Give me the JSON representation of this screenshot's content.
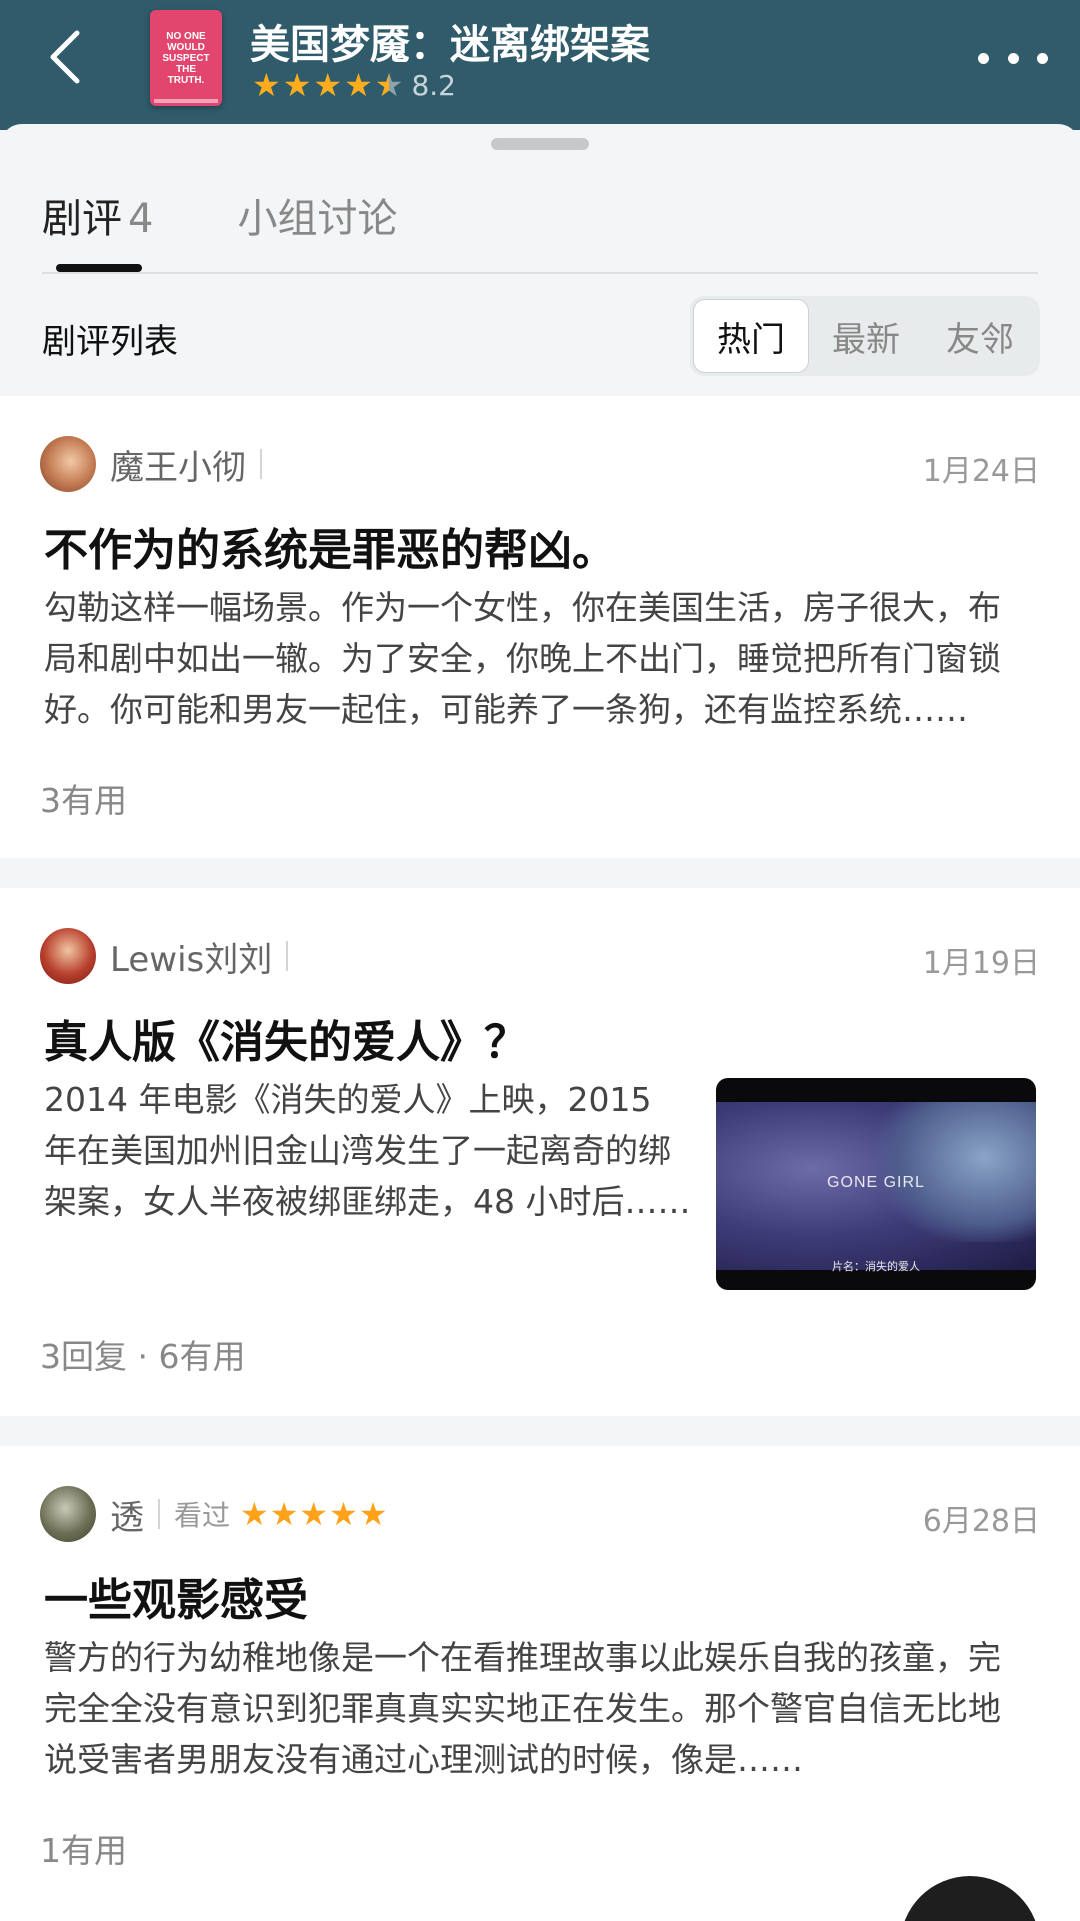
{
  "header": {
    "title": "美国梦魇：迷离绑架案",
    "rating": "8.2",
    "stars_filled": 4.5,
    "poster_lines": [
      "NO ONE",
      "WOULD",
      "SUSPECT",
      "THE",
      "TRUTH."
    ]
  },
  "tabs": [
    {
      "label": "剧评",
      "count": "4"
    },
    {
      "label": "小组讨论"
    }
  ],
  "list": {
    "title": "剧评列表",
    "sort_options": [
      "热门",
      "最新",
      "友邻"
    ],
    "selected_sort": "热门"
  },
  "reviews": [
    {
      "author": "魔王小彻",
      "date": "1月24日",
      "title": "不作为的系统是罪恶的帮凶。",
      "excerpt": "勾勒这样一幅场景。作为一个女性，你在美国生活，房子很大，布局和剧中如出一辙。为了安全，你晚上不出门，睡觉把所有门窗锁好。你可能和男友一起住，可能养了一条狗，还有监控系统……",
      "footer": "3有用"
    },
    {
      "author": "Lewis刘刘",
      "date": "1月19日",
      "title": "真人版《消失的爱人》？",
      "excerpt": "2014 年电影《消失的爱人》上映，2015 年在美国加州旧金山湾发生了一起离奇的绑架案，女人半夜被绑匪绑走，48 小时后……",
      "footer": "3回复 · 6有用",
      "thumbnail": {
        "movie_title": "GONE GIRL",
        "caption": "片名：消失的爱人"
      }
    },
    {
      "author": "透",
      "watched_label": "看过",
      "stars": "★★★★★",
      "date": "6月28日",
      "title": "一些观影感受",
      "excerpt": "警方的行为幼稚地像是一个在看推理故事以此娱乐自我的孩童，完完全全没有意识到犯罪真真实实地正在发生。那个警官自信无比地说受害者男朋友没有通过心理测试的时候，像是……",
      "footer": "1有用"
    }
  ],
  "colors": {
    "header_bg": "#2f5b6b",
    "star": "#ffad1f"
  }
}
